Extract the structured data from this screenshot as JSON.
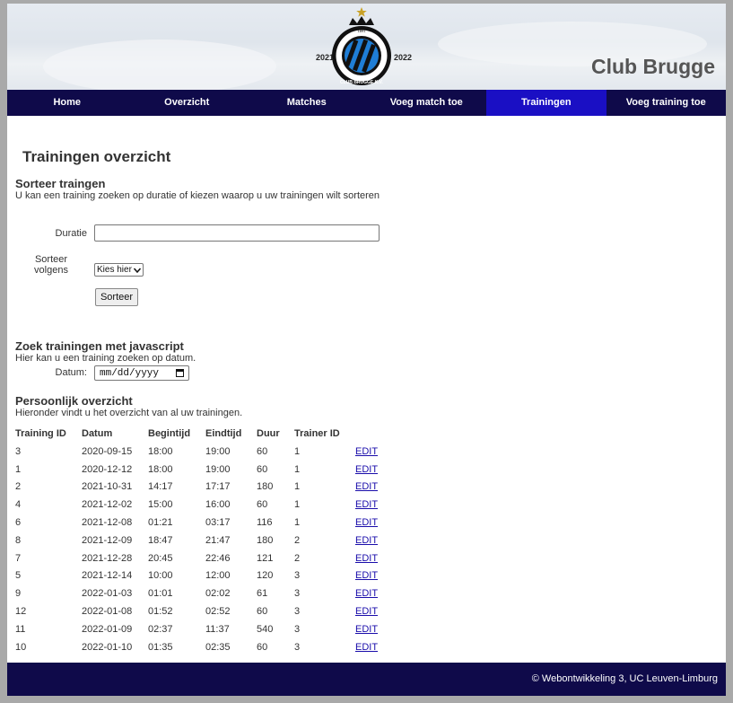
{
  "header": {
    "brand": "Club Brugge",
    "logo": {
      "year_left": "2021",
      "year_right": "2022",
      "ring_text": "CLUB BRUGGE K.V.",
      "badge_text": "1891"
    }
  },
  "nav": {
    "items": [
      {
        "label": "Home"
      },
      {
        "label": "Overzicht"
      },
      {
        "label": "Matches"
      },
      {
        "label": "Voeg match toe"
      },
      {
        "label": "Trainingen",
        "active": true
      },
      {
        "label": "Voeg training toe"
      }
    ]
  },
  "main": {
    "title": "Trainingen overzicht",
    "sort": {
      "heading": "Sorteer traingen",
      "description": "U kan een training zoeken op duratie of kiezen waarop u uw trainingen wilt sorteren",
      "duration_label": "Duratie",
      "duration_value": "",
      "sort_label_1": "Sorteer",
      "sort_label_2": "volgens",
      "sort_selected": "Kies hier",
      "button": "Sorteer"
    },
    "search": {
      "heading": "Zoek trainingen met javascript",
      "description": "Hier kan u een training zoeken op datum.",
      "date_label": "Datum:",
      "date_placeholder": "mm/dd/yyyy"
    },
    "overview": {
      "heading": "Persoonlijk overzicht",
      "description": "Hieronder vindt u het overzicht van al uw trainingen.",
      "columns": [
        "Training ID",
        "Datum",
        "Begintijd",
        "Eindtijd",
        "Duur",
        "Trainer ID",
        ""
      ],
      "edit_label": "EDIT",
      "rows": [
        [
          "3",
          "2020-09-15",
          "18:00",
          "19:00",
          "60",
          "1"
        ],
        [
          "1",
          "2020-12-12",
          "18:00",
          "19:00",
          "60",
          "1"
        ],
        [
          "2",
          "2021-10-31",
          "14:17",
          "17:17",
          "180",
          "1"
        ],
        [
          "4",
          "2021-12-02",
          "15:00",
          "16:00",
          "60",
          "1"
        ],
        [
          "6",
          "2021-12-08",
          "01:21",
          "03:17",
          "116",
          "1"
        ],
        [
          "8",
          "2021-12-09",
          "18:47",
          "21:47",
          "180",
          "2"
        ],
        [
          "7",
          "2021-12-28",
          "20:45",
          "22:46",
          "121",
          "2"
        ],
        [
          "5",
          "2021-12-14",
          "10:00",
          "12:00",
          "120",
          "3"
        ],
        [
          "9",
          "2022-01-03",
          "01:01",
          "02:02",
          "61",
          "3"
        ],
        [
          "12",
          "2022-01-08",
          "01:52",
          "02:52",
          "60",
          "3"
        ],
        [
          "11",
          "2022-01-09",
          "02:37",
          "11:37",
          "540",
          "3"
        ],
        [
          "10",
          "2022-01-10",
          "01:35",
          "02:35",
          "60",
          "3"
        ]
      ]
    }
  },
  "footer": {
    "text": "© Webontwikkeling 3, UC Leuven-Limburg"
  },
  "colors": {
    "nav_bg": "#0f0a4a",
    "nav_active": "#1a0fc4",
    "link": "#1a0dab"
  }
}
